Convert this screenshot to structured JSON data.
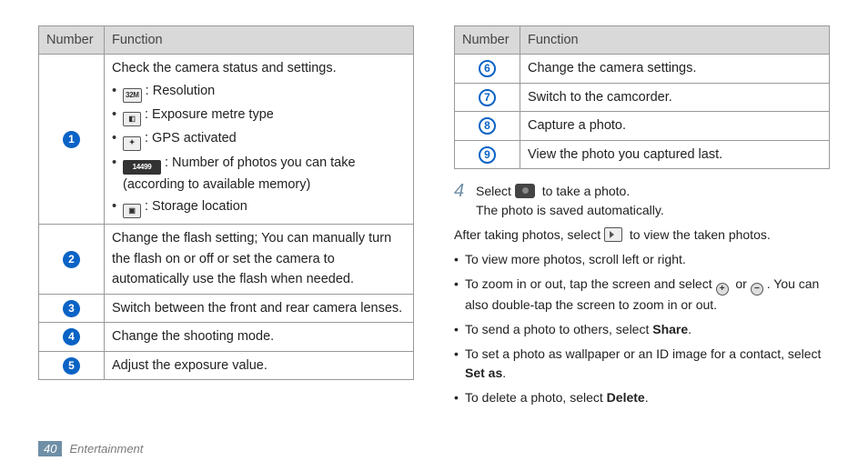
{
  "tables": {
    "left": {
      "headers": [
        "Number",
        "Function"
      ],
      "rows": [
        {
          "num": "1",
          "intro": "Check the camera status and settings.",
          "items": [
            {
              "icon_label": "32M",
              "icon_kind": "light",
              "text": ": Resolution"
            },
            {
              "icon_label": "",
              "icon_kind": "exposure",
              "text": ": Exposure metre type"
            },
            {
              "icon_label": "",
              "icon_kind": "gps",
              "text": ": GPS activated"
            },
            {
              "icon_label": "14499",
              "icon_kind": "dark",
              "text": ": Number of photos you can take (according to available memory)"
            },
            {
              "icon_label": "",
              "icon_kind": "storage",
              "text": ": Storage location"
            }
          ]
        },
        {
          "num": "2",
          "text": "Change the flash setting; You can manually turn the flash on or off or set the camera to automatically use the flash when needed."
        },
        {
          "num": "3",
          "text": "Switch between the front and rear camera lenses."
        },
        {
          "num": "4",
          "text": "Change the shooting mode."
        },
        {
          "num": "5",
          "text": "Adjust the exposure value."
        }
      ]
    },
    "right": {
      "headers": [
        "Number",
        "Function"
      ],
      "rows": [
        {
          "num": "6",
          "text": "Change the camera settings."
        },
        {
          "num": "7",
          "text": "Switch to the camcorder."
        },
        {
          "num": "8",
          "text": "Capture a photo."
        },
        {
          "num": "9",
          "text": "View the photo you captured last."
        }
      ]
    }
  },
  "step": {
    "num": "4",
    "line1a": "Select ",
    "line1b": " to take a photo.",
    "line2": "The photo is saved automatically."
  },
  "after": {
    "intro_a": "After taking photos, select ",
    "intro_b": " to view the taken photos.",
    "bullets": [
      {
        "text": "To view more photos, scroll left or right."
      },
      {
        "zoom": true,
        "a": "To zoom in or out, tap the screen and select ",
        "b": " or ",
        "c": ". You can also double-tap the screen to zoom in or out."
      },
      {
        "pre": "To send a photo to others, select ",
        "bold": "Share",
        "post": "."
      },
      {
        "pre": "To set a photo as wallpaper or an ID image for a contact, select ",
        "bold": "Set as",
        "post": "."
      },
      {
        "pre": "To delete a photo, select ",
        "bold": "Delete",
        "post": "."
      }
    ]
  },
  "footer": {
    "page": "40",
    "section": "Entertainment"
  },
  "icons": {
    "exposure": "exposure-metre-icon",
    "gps": "gps-activated-icon",
    "storage": "storage-location-icon",
    "camera": "camera-icon",
    "play": "play-icon",
    "zoom_in": "zoom-in-icon",
    "zoom_out": "zoom-out-icon"
  }
}
